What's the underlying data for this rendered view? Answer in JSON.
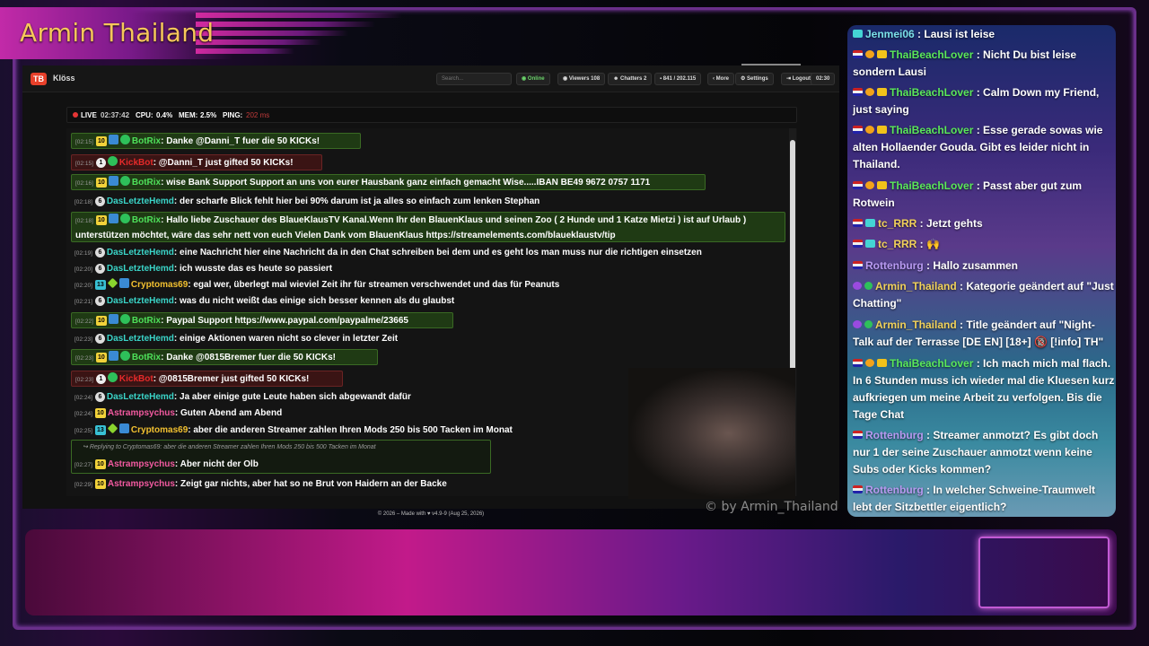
{
  "channel_title": "Armin Thailand",
  "app": {
    "logo": "TB",
    "name": "Klöss",
    "search_placeholder": "Search...",
    "status_online": "Online",
    "viewers": "Viewers 108",
    "chatters": "Chatters 2",
    "messages": "841 / 202.115",
    "more": "More",
    "settings": "Settings",
    "logout": "Logout",
    "clock": "02:30"
  },
  "status": {
    "live": "LIVE",
    "uptime": "02:37:42",
    "cpu_label": "CPU:",
    "cpu": "0.4%",
    "mem_label": "MEM:",
    "mem": "2.5%",
    "ping_label": "PING:",
    "ping": "202 ms"
  },
  "chat": [
    {
      "ts": "[02:15]",
      "lvl": "10",
      "name": "BotRix",
      "text": ": Danke @Danni_T fuer die 50 KICKs!"
    },
    {
      "ts": "[02:15]",
      "lvl": "1",
      "name": "KickBot",
      "text": ": @Danni_T just gifted 50 KICKs!"
    },
    {
      "ts": "[02:16]",
      "lvl": "10",
      "name": "BotRix",
      "text": ": wise Bank Support Support an uns von eurer Hausbank ganz einfach gemacht Wise.....IBAN BE49 9672 0757 1171"
    },
    {
      "ts": "[02:18]",
      "lvl": "6",
      "name": "DasLetzteHemd",
      "text": ": der scharfe Blick fehlt hier bei 90% darum ist ja alles so einfach zum lenken Stephan"
    },
    {
      "ts": "[02:18]",
      "lvl": "10",
      "name": "BotRix",
      "text": ": Hallo liebe Zuschauer des BlaueKlausTV Kanal.Wenn Ihr den BlauenKlaus und seinen Zoo ( 2 Hunde und 1 Katze Mietzi ) ist auf Urlaub ) unterstützen möchtet, wäre das sehr nett von euch Vielen Dank vom BlauenKlaus https://streamelements.com/blaueklaustv/tip"
    },
    {
      "ts": "[02:19]",
      "lvl": "6",
      "name": "DasLetzteHemd",
      "text": ": eine Nachricht hier eine Nachricht da in den Chat schreiben bei dem und es geht los man muss nur die richtigen einsetzen"
    },
    {
      "ts": "[02:20]",
      "lvl": "6",
      "name": "DasLetzteHemd",
      "text": ": ich wusste das es heute so passiert"
    },
    {
      "ts": "[02:20]",
      "lvl": "13",
      "name": "Cryptomas69",
      "text": ": egal wer, überlegt mal wieviel Zeit ihr für streamen verschwendet und das für Peanuts"
    },
    {
      "ts": "[02:21]",
      "lvl": "6",
      "name": "DasLetzteHemd",
      "text": ": was du nicht weißt das einige sich besser kennen als du glaubst"
    },
    {
      "ts": "[02:22]",
      "lvl": "10",
      "name": "BotRix",
      "text": ": Paypal Support https://www.paypal.com/paypalme/23665"
    },
    {
      "ts": "[02:23]",
      "lvl": "6",
      "name": "DasLetzteHemd",
      "text": ": einige Aktionen waren nicht so clever in letzter Zeit"
    },
    {
      "ts": "[02:23]",
      "lvl": "10",
      "name": "BotRix",
      "text": ": Danke @0815Bremer fuer die 50 KICKs!"
    },
    {
      "ts": "[02:23]",
      "lvl": "1",
      "name": "KickBot",
      "text": ": @0815Bremer just gifted 50 KICKs!"
    },
    {
      "ts": "[02:24]",
      "lvl": "6",
      "name": "DasLetzteHemd",
      "text": ": Ja aber einige gute Leute haben sich abgewandt dafür"
    },
    {
      "ts": "[02:24]",
      "lvl": "10",
      "name": "Astrampsychus",
      "text": ": Guten Abend am Abend"
    },
    {
      "ts": "[02:25]",
      "lvl": "13",
      "name": "Cryptomas69",
      "text": ": aber die anderen Streamer zahlen Ihren Mods 250 bis 500 Tacken im Monat"
    },
    {
      "ts": "[02:27]",
      "lvl": "10",
      "name": "Astrampsychus",
      "text": ": Aber nicht der Olb"
    },
    {
      "ts": "[02:29]",
      "lvl": "10",
      "name": "Astrampsychus",
      "text": ": Zeigt gar nichts, aber hat so ne Brut von Haidern an der Backe"
    }
  ],
  "reply": "Replying to Cryptomas69: aber die anderen Streamer zahlen Ihren Mods 250 bis 500 Tacken im Monat",
  "footer": "© 2026 – Made with ♥ v4.9-9 (Aug 25, 2026)",
  "watermark": "© by Armin_Thailand",
  "right_chat": [
    {
      "name": "Jenmei06",
      "text": " : Lausi ist leise"
    },
    {
      "name": "ThaiBeachLover",
      "text": " : Nicht Du bist leise sondern Lausi"
    },
    {
      "name": "ThaiBeachLover",
      "text": " : Calm Down my Friend, just saying"
    },
    {
      "name": "ThaiBeachLover",
      "text": " : Esse gerade sowas wie alten Hollaender Gouda. Gibt es leider nicht in Thailand."
    },
    {
      "name": "ThaiBeachLover",
      "text": " : Passt aber gut zum Rotwein"
    },
    {
      "name": "tc_RRR",
      "text": " : Jetzt gehts"
    },
    {
      "name": "tc_RRR",
      "text": " : 🙌"
    },
    {
      "name": "Rottenburg",
      "text": " : Hallo zusammen"
    },
    {
      "name": "Armin_Thailand",
      "text": " : Kategorie geändert auf \"Just Chatting\""
    },
    {
      "name": "Armin_Thailand",
      "text": " : Title geändert auf \"Night-Talk auf der Terrasse [DE EN] [18+] 🔞 [!info] TH\""
    },
    {
      "name": "ThaiBeachLover",
      "text": " : Ich mach mich mal flach. In 6 Stunden muss ich wieder mal die Kluesen kurz aufkriegen um meine Arbeit zu verfolgen. Bis die Tage Chat"
    },
    {
      "name": "Rottenburg",
      "text": " : Streamer anmotzt? Es gibt doch nur 1 der seine Zuschauer anmotzt wenn keine Subs oder Kicks kommen?"
    },
    {
      "name": "Rottenburg",
      "text": " : In welcher Schweine-Traumwelt lebt der Sitzbettler eigentlich?"
    }
  ]
}
